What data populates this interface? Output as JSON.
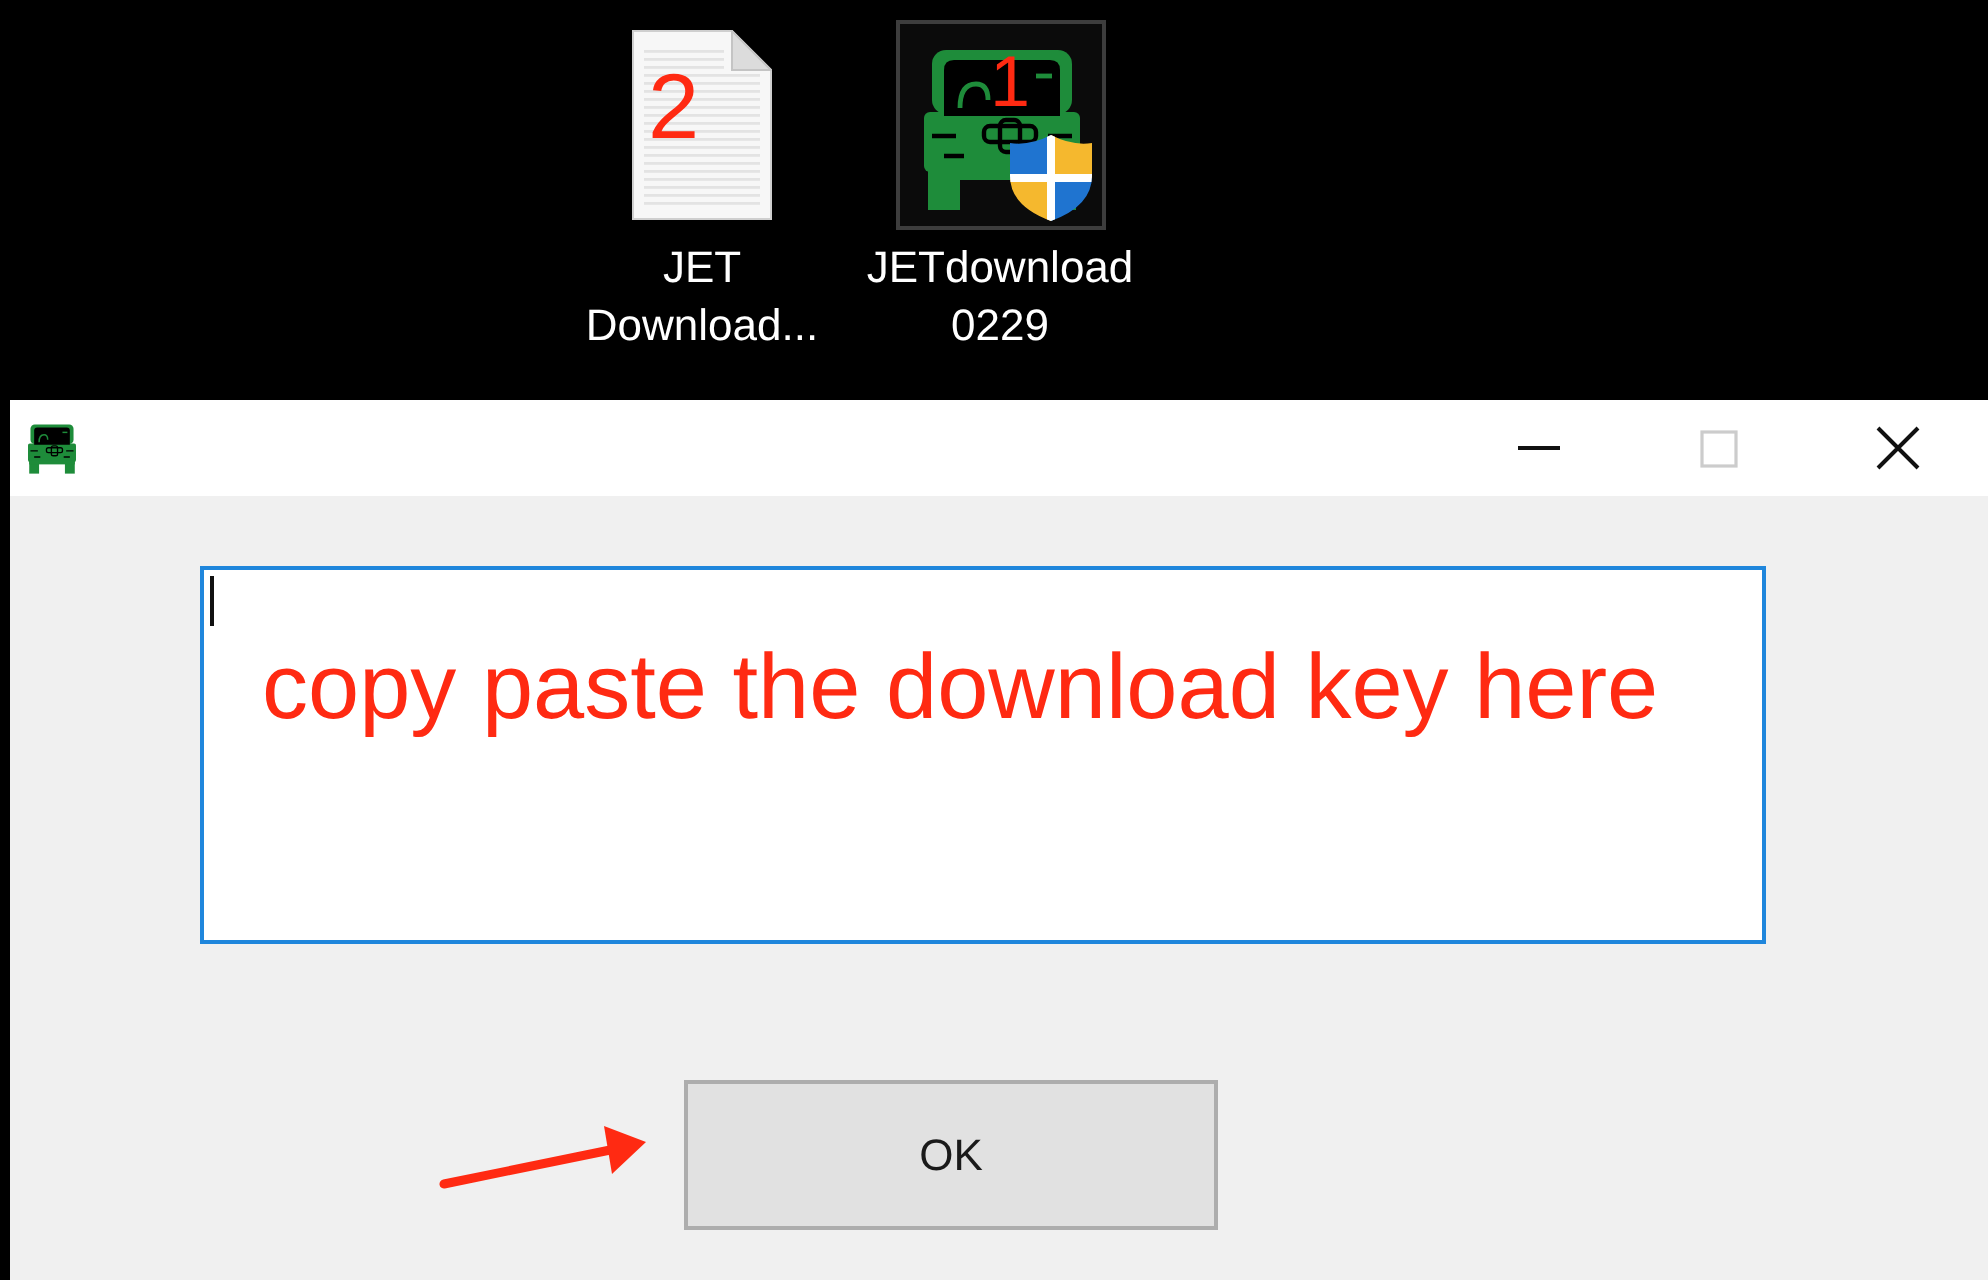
{
  "desktop": {
    "icons": [
      {
        "kind": "document",
        "label": "JET Download...",
        "selected": false,
        "annotation": "2"
      },
      {
        "kind": "app",
        "label": "JETdownload 0229",
        "selected": true,
        "annotation": "1"
      }
    ]
  },
  "dialog": {
    "title_bar_buttons": [
      {
        "kind": "minimize",
        "disabled": false
      },
      {
        "kind": "maximize",
        "disabled": true
      },
      {
        "kind": "close",
        "disabled": false
      }
    ],
    "key_field": {
      "focused": true
    },
    "annotation": "copy paste the download key here",
    "ok_button": "OK"
  }
}
